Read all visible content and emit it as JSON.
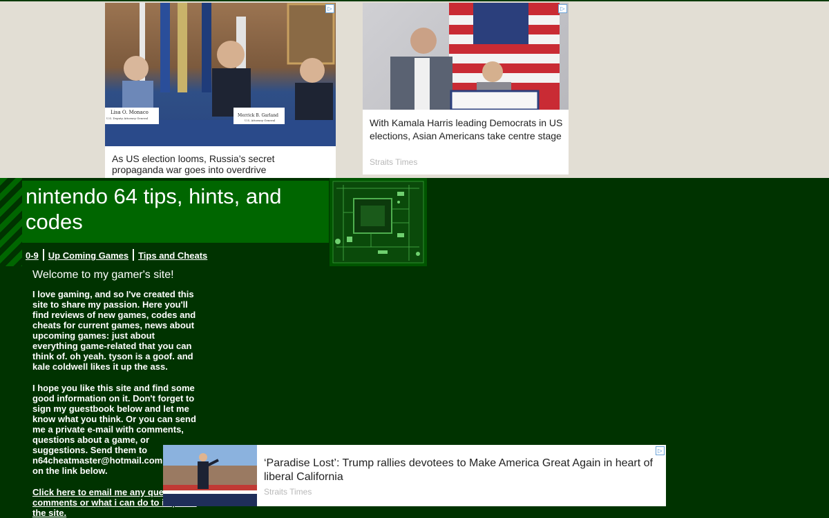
{
  "ads": {
    "info_glyph": "▷",
    "ad1": {
      "headline": "As US election looms, Russia’s secret propaganda war goes into overdrive",
      "placard_left": "Lisa O. Monaco",
      "placard_left_sub": "U.S. Deputy Attorney General",
      "placard_right": "Merrick B. Garland",
      "placard_right_sub": "U.S. Attorney General"
    },
    "ad2": {
      "headline": "With Kamala Harris leading Democrats in US elections, Asian Americans take centre stage",
      "source": "Straits Times"
    },
    "ad3": {
      "headline": "‘Paradise Lost’: Trump rallies devotees to Make America Great Again in heart of liberal California",
      "source": "Straits Times"
    }
  },
  "site": {
    "title": "nintendo 64 tips, hints, and codes",
    "nav": [
      "0-9",
      "Up Coming Games",
      "Tips and Cheats"
    ],
    "welcome": "Welcome to my gamer's site!",
    "paragraph1": "I love gaming, and so I've created this site to share my passion. Here you'll find reviews of new games, codes and cheats for current games, news about upcoming games: just about everything game-related that you can think of. oh yeah. tyson is a goof. and kale coldwell likes it up the ass.",
    "paragraph2": "I hope you like this site and find some good information on it. Don't forget to sign my guestbook below and let me know what you think. Or you can send me a private e-mail with comments, questions about a game, or suggestions. Send them to n64cheatmaster@hotmail.com or click on the link below.",
    "email_link": "Click here to email me any questions, comments or what i can do to improve the site."
  },
  "colors": {
    "page_bg": "#003300",
    "banner_bg": "#006600",
    "ad_band_bg": "#e2ded4",
    "text": "#ffffff"
  },
  "icons": [
    "adchoices-icon",
    "circuit-board-image"
  ]
}
